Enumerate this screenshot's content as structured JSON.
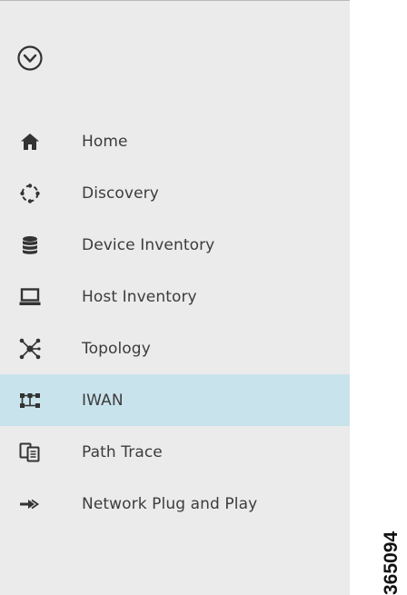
{
  "sidebar": {
    "collapse_icon": "chevron-circle-down-icon",
    "active_background": "#c9e3ec",
    "items": [
      {
        "label": "Home",
        "icon": "home-icon"
      },
      {
        "label": "Discovery",
        "icon": "discovery-icon"
      },
      {
        "label": "Device Inventory",
        "icon": "database-icon"
      },
      {
        "label": "Host Inventory",
        "icon": "laptop-icon"
      },
      {
        "label": "Topology",
        "icon": "topology-icon"
      },
      {
        "label": "IWAN",
        "icon": "iwan-icon",
        "active": true
      },
      {
        "label": "Path Trace",
        "icon": "path-trace-icon"
      },
      {
        "label": "Network Plug and Play",
        "icon": "plug-and-play-icon"
      }
    ]
  },
  "figure_id": "365094"
}
